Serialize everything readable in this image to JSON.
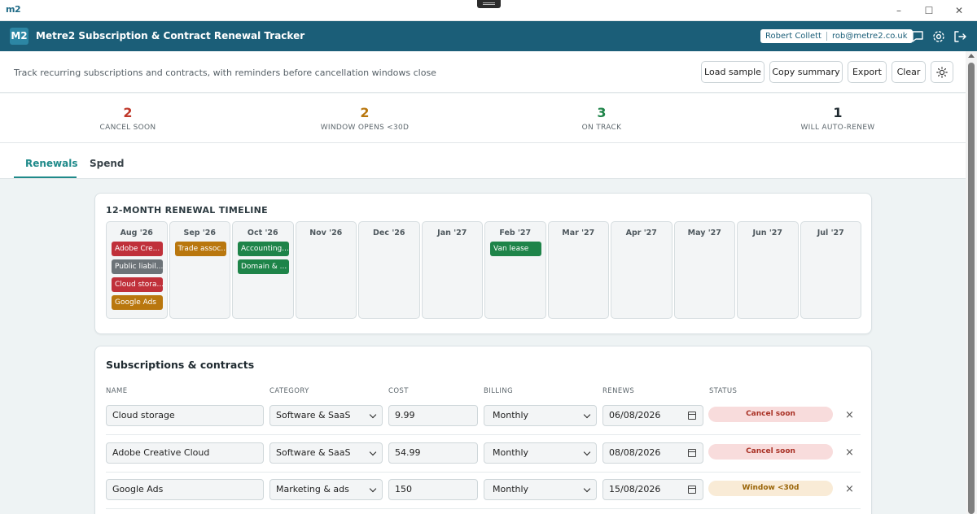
{
  "os": {
    "logo": "m2",
    "minimize": "–",
    "maximize": "☐",
    "close": "✕"
  },
  "app": {
    "logo": "M2",
    "title": "Metre2 Subscription & Contract Renewal Tracker",
    "user_name": "Robert Collett",
    "user_email": "rob@metre2.co.uk"
  },
  "toolbar": {
    "tagline": "Track recurring subscriptions and contracts, with reminders before cancellation windows close",
    "load_sample": "Load sample",
    "copy_summary": "Copy summary",
    "export": "Export",
    "clear": "Clear"
  },
  "stats": [
    {
      "value": "2",
      "label": "CANCEL SOON",
      "color": "#c0392b"
    },
    {
      "value": "2",
      "label": "WINDOW OPENS <30D",
      "color": "#b9770e"
    },
    {
      "value": "3",
      "label": "ON TRACK",
      "color": "#1e8449"
    },
    {
      "value": "1",
      "label": "WILL AUTO-RENEW",
      "color": "#1f2a30"
    }
  ],
  "tabs": {
    "renewals": "Renewals",
    "spend": "Spend"
  },
  "timeline": {
    "title": "12-MONTH RENEWAL TIMELINE",
    "months": [
      {
        "name": "Aug '26",
        "chips": [
          {
            "label": "Adobe Cre...",
            "color": "#c0303a"
          },
          {
            "label": "Public liabil...",
            "color": "#6c7378"
          },
          {
            "label": "Cloud stora...",
            "color": "#c0303a"
          },
          {
            "label": "Google Ads",
            "color": "#b9770e"
          }
        ]
      },
      {
        "name": "Sep '26",
        "chips": [
          {
            "label": "Trade assoc...",
            "color": "#b9770e"
          }
        ]
      },
      {
        "name": "Oct '26",
        "chips": [
          {
            "label": "Accounting...",
            "color": "#1e8449"
          },
          {
            "label": "Domain & ...",
            "color": "#1e8449"
          }
        ]
      },
      {
        "name": "Nov '26",
        "chips": []
      },
      {
        "name": "Dec '26",
        "chips": []
      },
      {
        "name": "Jan '27",
        "chips": []
      },
      {
        "name": "Feb '27",
        "chips": [
          {
            "label": "Van lease",
            "color": "#1e8449"
          }
        ]
      },
      {
        "name": "Mar '27",
        "chips": []
      },
      {
        "name": "Apr '27",
        "chips": []
      },
      {
        "name": "May '27",
        "chips": []
      },
      {
        "name": "Jun '27",
        "chips": []
      },
      {
        "name": "Jul '27",
        "chips": []
      }
    ]
  },
  "subs": {
    "title": "Subscriptions & contracts",
    "headers": {
      "name": "NAME",
      "category": "CATEGORY",
      "cost": "COST",
      "billing": "BILLING",
      "renews": "RENEWS",
      "status": "STATUS"
    },
    "rows": [
      {
        "name": "Cloud storage",
        "category": "Software & SaaS",
        "cost": "9.99",
        "billing": "Monthly",
        "renews": "06/08/2026",
        "status": "Cancel soon",
        "status_bg": "#f8dcdc",
        "status_fg": "#a93226"
      },
      {
        "name": "Adobe Creative Cloud",
        "category": "Software & SaaS",
        "cost": "54.99",
        "billing": "Monthly",
        "renews": "08/08/2026",
        "status": "Cancel soon",
        "status_bg": "#f8dcdc",
        "status_fg": "#a93226"
      },
      {
        "name": "Google Ads",
        "category": "Marketing & ads",
        "cost": "150",
        "billing": "Monthly",
        "renews": "15/08/2026",
        "status": "Window <30d",
        "status_bg": "#f9ebd6",
        "status_fg": "#9a6508"
      }
    ],
    "delete_symbol": "×"
  }
}
